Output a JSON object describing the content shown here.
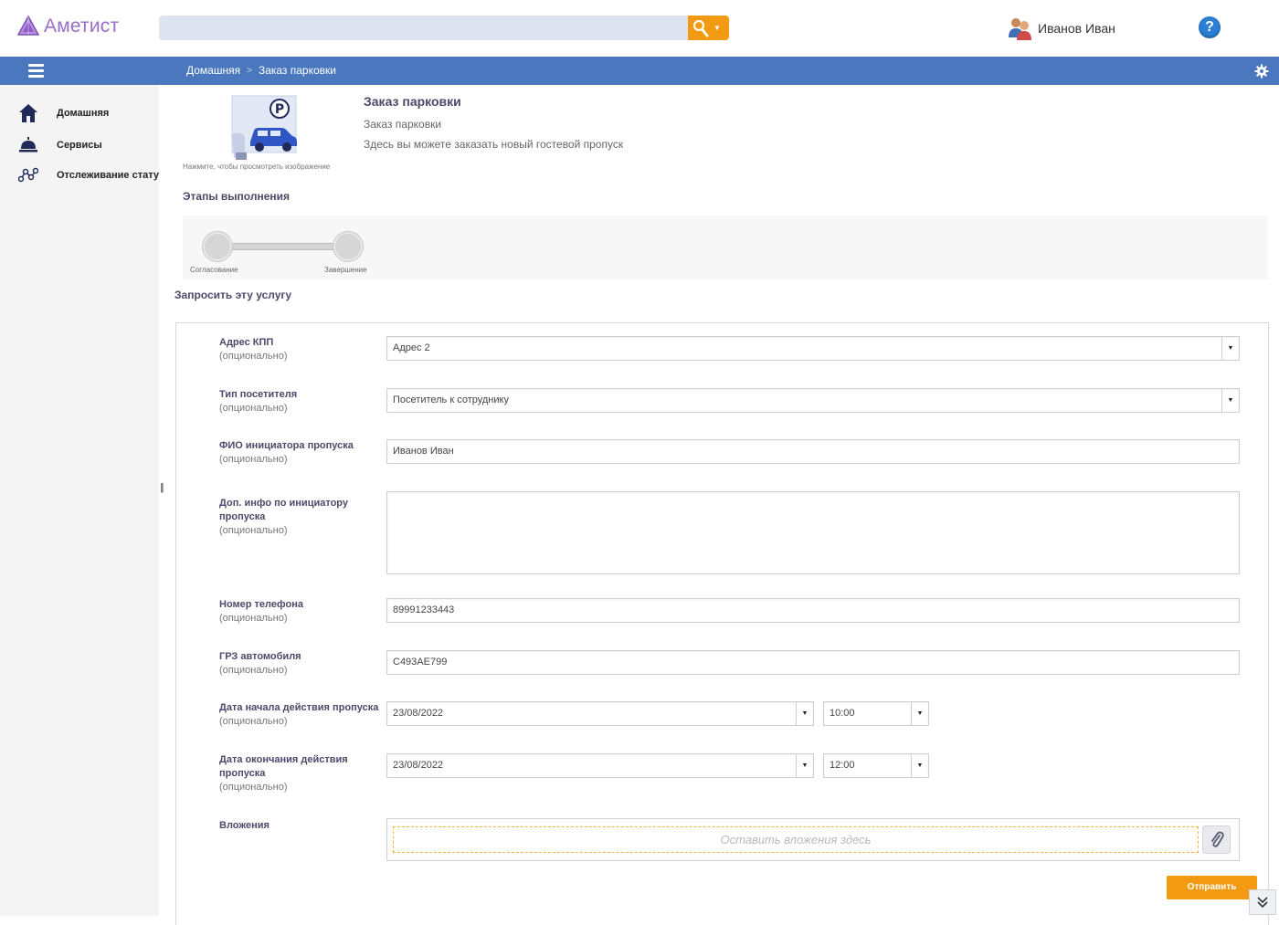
{
  "app": {
    "logo_text": "Аметист",
    "brand_color": "#9a6fc7",
    "accent_color": "#f29a12",
    "nav_color": "#4a77bd"
  },
  "header": {
    "search": {
      "value": "",
      "placeholder": ""
    },
    "user_name": "Иванов Иван",
    "help_label": "?"
  },
  "breadcrumbs": [
    "Домашняя",
    "Заказ парковки"
  ],
  "breadcrumb_separator": ">",
  "sidebar": {
    "items": [
      {
        "label": "Домашняя",
        "icon": "home-icon"
      },
      {
        "label": "Сервисы",
        "icon": "service-bell-icon"
      },
      {
        "label": "Отслеживание статуса",
        "icon": "tracking-icon"
      }
    ]
  },
  "service": {
    "image_caption": "Нажмите, чтобы просмотреть изображение",
    "title": "Заказ парковки",
    "subtitle": "Заказ парковки",
    "description": "Здесь вы можете заказать новый гостевой пропуск"
  },
  "stages": {
    "title": "Этапы выполнения",
    "items": [
      "Согласование",
      "Завершение"
    ]
  },
  "request": {
    "title": "Запросить эту услугу",
    "optional_text": "(опционально)",
    "fields": {
      "address": {
        "label": "Адрес КПП",
        "value": "Адрес 2"
      },
      "visitor_type": {
        "label": "Тип посетителя",
        "value": "Посетитель к сотруднику"
      },
      "initiator": {
        "label": "ФИО инициатора пропуска",
        "value": "Иванов Иван"
      },
      "extra_info": {
        "label_line1": "Доп. инфо по инициатору",
        "label_line2": "пропуска",
        "value": ""
      },
      "phone": {
        "label": "Номер телефона",
        "value": "89991233443"
      },
      "car_plate": {
        "label": "ГРЗ автомобиля",
        "value": "С493АЕ799"
      },
      "start": {
        "label": "Дата начала действия пропуска",
        "date": "23/08/2022",
        "time": "10:00"
      },
      "end": {
        "label_line1": "Дата окончания действия",
        "label_line2": "пропуска",
        "date": "23/08/2022",
        "time": "12:00"
      },
      "attachments": {
        "label": "Вложения",
        "dropzone_text": "Оставить вложения здесь"
      }
    },
    "submit_label": "Отправить"
  }
}
